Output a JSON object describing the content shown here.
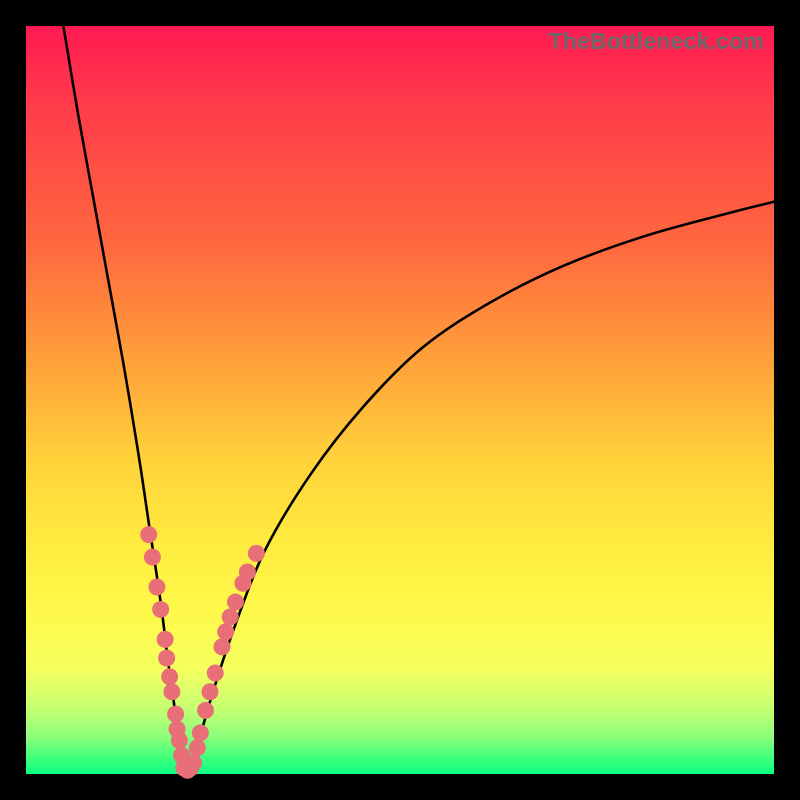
{
  "watermark": "TheBottleneck.com",
  "colors": {
    "background_frame": "#000000",
    "gradient_top": "#ff1a52",
    "gradient_mid": "#ffe93e",
    "gradient_bottom": "#0aff82",
    "curve": "#000000",
    "dot": "#e86f78"
  },
  "chart_data": {
    "type": "line",
    "title": "",
    "xlabel": "",
    "ylabel": "",
    "xlim": [
      0,
      100
    ],
    "ylim": [
      0,
      100
    ],
    "series": [
      {
        "name": "left-curve",
        "x": [
          5,
          7,
          9,
          11,
          13,
          15,
          16.5,
          18,
          19,
          20,
          20.8,
          21.1
        ],
        "y": [
          100,
          88,
          77,
          66,
          55,
          43,
          33,
          23,
          15,
          8,
          3,
          0
        ]
      },
      {
        "name": "right-curve",
        "x": [
          22.0,
          23,
          25,
          28,
          32,
          38,
          45,
          53,
          62,
          72,
          83,
          94,
          100
        ],
        "y": [
          0,
          4,
          11,
          20,
          30,
          40,
          49,
          57,
          63,
          68,
          72,
          75,
          76.5
        ]
      }
    ],
    "annotations": {
      "name": "highlight-dots",
      "points": [
        {
          "x": 16.4,
          "y": 32.0
        },
        {
          "x": 16.9,
          "y": 29.0
        },
        {
          "x": 17.5,
          "y": 25.0
        },
        {
          "x": 18.0,
          "y": 22.0
        },
        {
          "x": 18.6,
          "y": 18.0
        },
        {
          "x": 18.8,
          "y": 15.5
        },
        {
          "x": 19.2,
          "y": 13.0
        },
        {
          "x": 19.5,
          "y": 11.0
        },
        {
          "x": 20.0,
          "y": 8.0
        },
        {
          "x": 20.2,
          "y": 6.0
        },
        {
          "x": 20.5,
          "y": 4.5
        },
        {
          "x": 20.8,
          "y": 2.5
        },
        {
          "x": 21.1,
          "y": 0.8
        },
        {
          "x": 21.6,
          "y": 0.5
        },
        {
          "x": 22.0,
          "y": 0.8
        },
        {
          "x": 22.4,
          "y": 1.5
        },
        {
          "x": 22.9,
          "y": 3.5
        },
        {
          "x": 23.3,
          "y": 5.5
        },
        {
          "x": 24.0,
          "y": 8.5
        },
        {
          "x": 24.6,
          "y": 11.0
        },
        {
          "x": 25.3,
          "y": 13.5
        },
        {
          "x": 26.2,
          "y": 17.0
        },
        {
          "x": 26.7,
          "y": 19.0
        },
        {
          "x": 27.3,
          "y": 21.0
        },
        {
          "x": 28.0,
          "y": 23.0
        },
        {
          "x": 29.0,
          "y": 25.5
        },
        {
          "x": 29.6,
          "y": 27.0
        },
        {
          "x": 30.8,
          "y": 29.5
        }
      ]
    }
  }
}
